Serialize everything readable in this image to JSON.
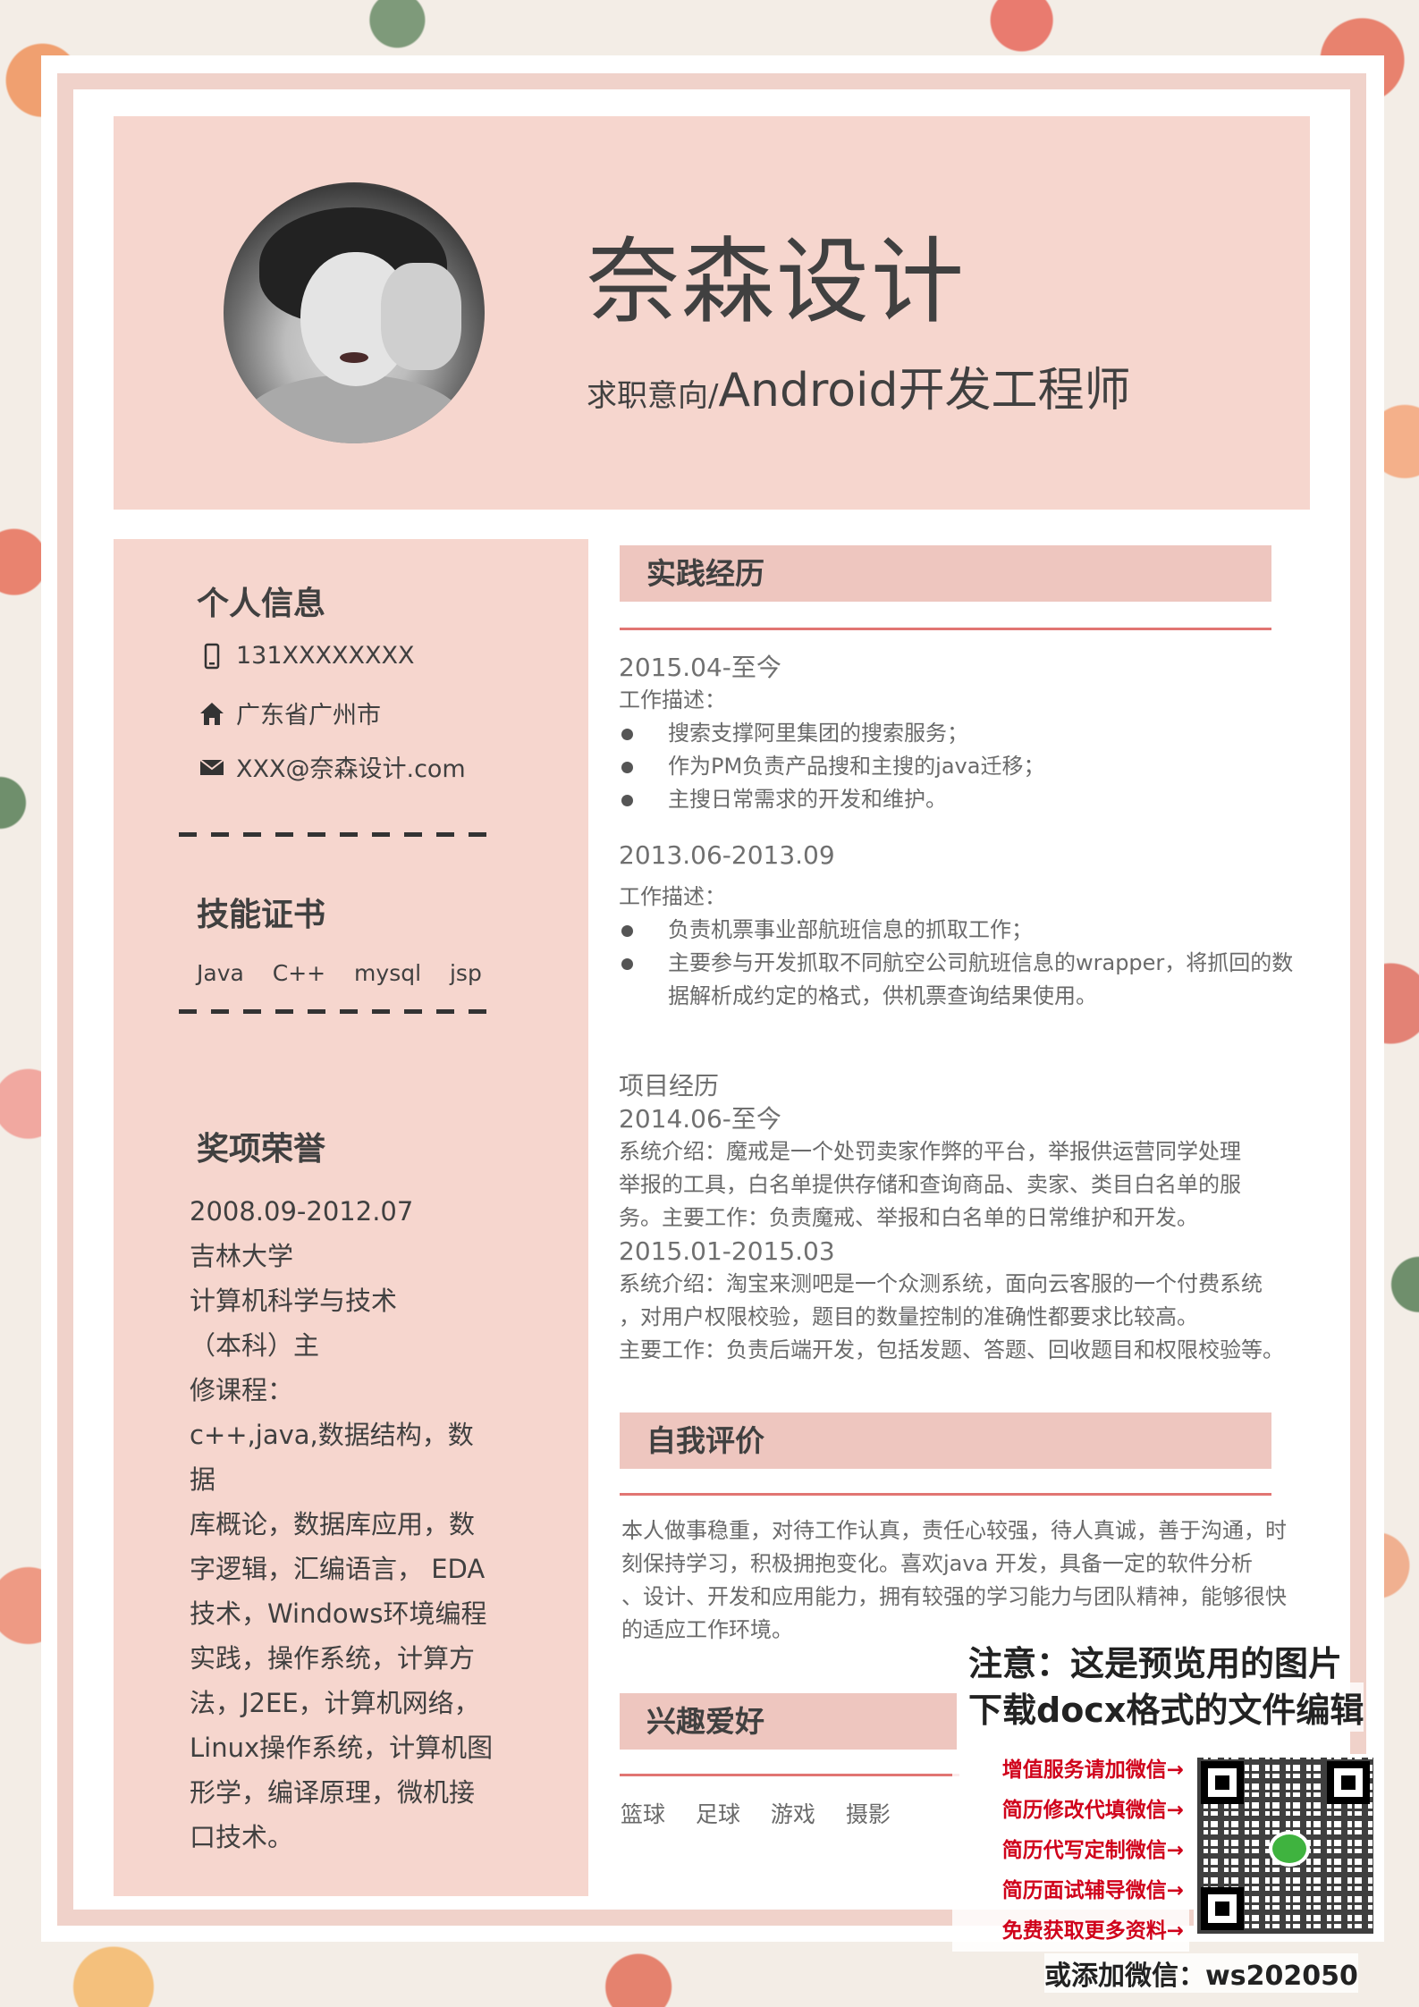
{
  "header": {
    "name": "奈森设计",
    "objective_label": "求职意向/",
    "objective_value": "Android开发工程师"
  },
  "personal": {
    "title": "个人信息",
    "phone": "131XXXXXXXX",
    "address": "广东省广州市",
    "email": "XXX@奈森设计.com"
  },
  "skills": {
    "title": "技能证书",
    "items": "Java  C++  mysql jsp"
  },
  "awards": {
    "title": "奖项荣誉",
    "lines": [
      "2008.09-2012.07",
      "吉林大学",
      "计算机科学与技术",
      "（本科）主",
      "修课程：",
      "c++,java,数据结构，数据",
      "库概论，数据库应用，数",
      "字逻辑，汇编语言， EDA",
      "技术，Windows环境编程",
      "实践，操作系统，计算方",
      "法，J2EE，计算机网络，",
      "Linux操作系统，计算机图",
      "形学，编译原理，微机接",
      "口技术。"
    ]
  },
  "practice": {
    "title": "实践经历",
    "job1_date": "2015.04-至今",
    "job1_desc_label": "工作描述：",
    "job1_items": [
      "搜索支撑阿里集团的搜索服务；",
      "作为PM负责产品搜和主搜的java迁移；",
      "主搜日常需求的开发和维护。"
    ],
    "job2_date": "2013.06-2013.09",
    "job2_desc_label": "工作描述：",
    "job2_items": [
      "负责机票事业部航班信息的抓取工作；",
      "主要参与开发抓取不同航空公司航班信息的wrapper，将抓回的数",
      "据解析成约定的格式，供机票查询结果使用。"
    ],
    "project_label": "项目经历",
    "proj1_date": "2014.06-至今",
    "proj1_lines": [
      "系统介绍：魔戒是一个处罚卖家作弊的平台，举报供运营同学处理",
      "举报的工具，白名单提供存储和查询商品、卖家、类目白名单的服",
      "务。主要工作：负责魔戒、举报和白名单的日常维护和开发。"
    ],
    "proj2_date": "2015.01-2015.03",
    "proj2_lines": [
      "系统介绍：淘宝来测吧是一个众测系统，面向云客服的一个付费系统",
      "，对用户权限校验，题目的数量控制的准确性都要求比较高。",
      "主要工作：负责后端开发，包括发题、答题、回收题目和权限校验等。"
    ]
  },
  "self_eval": {
    "title": "自我评价",
    "lines": [
      "本人做事稳重，对待工作认真，责任心较强，待人真诚，善于沟通，时",
      "刻保持学习，积极拥抱变化。喜欢java  开发，具备一定的软件分析",
      "、设计、开发和应用能力，拥有较强的学习能力与团队精神，能够很快",
      "的适应工作环境。"
    ]
  },
  "hobbies": {
    "title": "兴趣爱好",
    "items": "篮球 足球 游戏 摄影"
  },
  "watermark": {
    "line1": "注意：这是预览用的图片",
    "line2": "下载docx格式的文件编辑",
    "services": [
      "增值服务请加微信→",
      "简历修改代填微信→",
      "简历代写定制微信→",
      "简历面试辅导微信→",
      "免费获取更多资料→"
    ],
    "footer": "或添加微信：ws202050"
  },
  "colors": {
    "accent_pink": "#f6d6ce",
    "bar_pink": "#eec6bf",
    "rule_red": "#d9534f",
    "service_red": "#d0021b"
  },
  "icons": [
    "phone-icon",
    "home-icon",
    "mail-icon",
    "wechat-icon"
  ]
}
